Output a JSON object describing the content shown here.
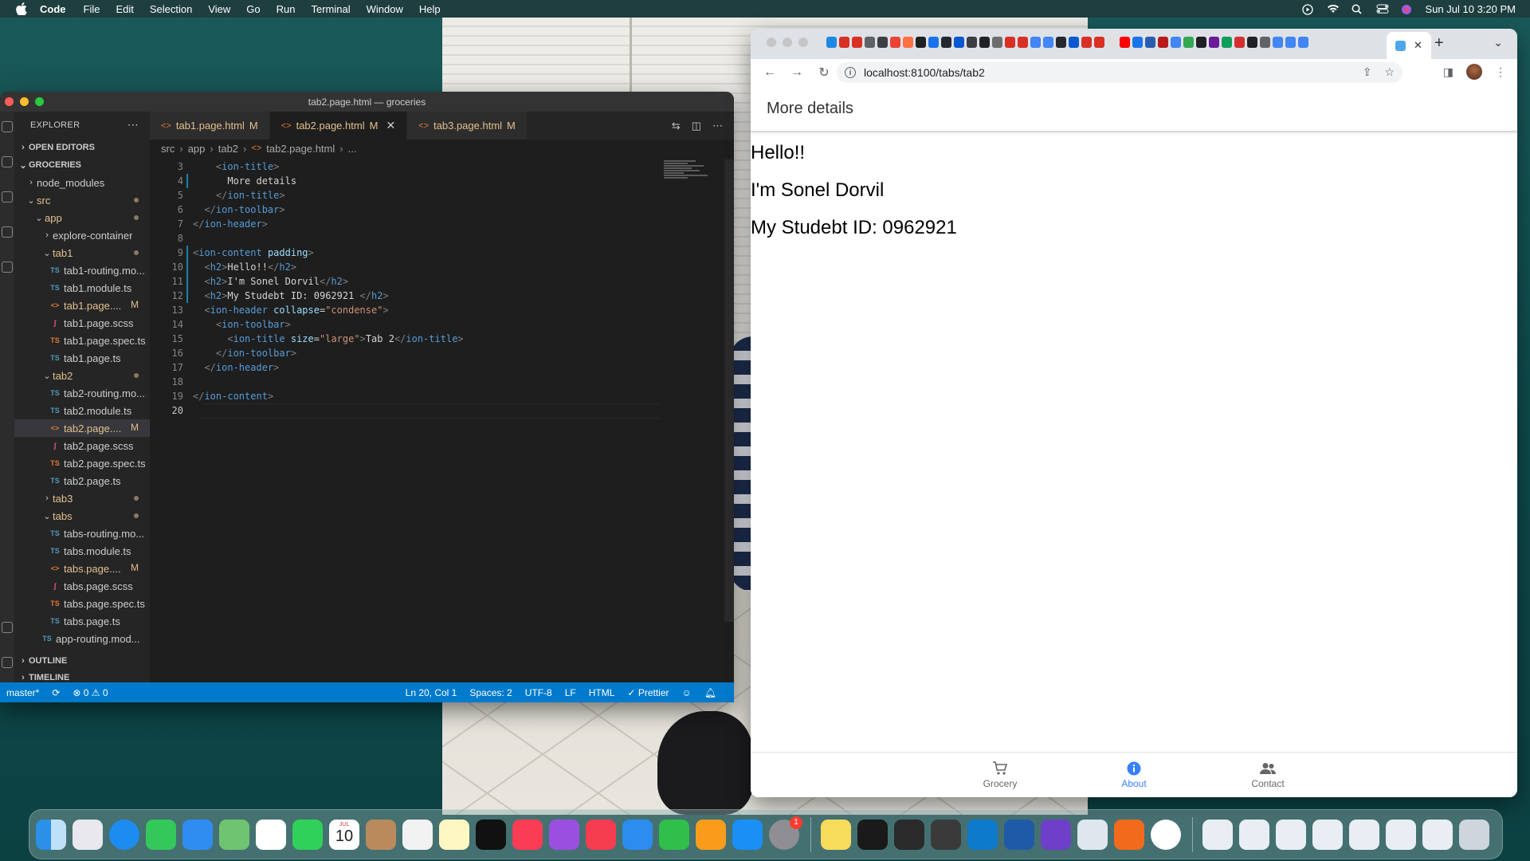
{
  "menubar": {
    "app_name": "Code",
    "items": [
      "File",
      "Edit",
      "Selection",
      "View",
      "Go",
      "Run",
      "Terminal",
      "Window",
      "Help"
    ],
    "datetime": "Sun Jul 10  3:20 PM"
  },
  "vscode": {
    "window_title": "tab2.page.html — groceries",
    "explorer_label": "EXPLORER",
    "open_editors_label": "OPEN EDITORS",
    "project_label": "GROCERIES",
    "outline_label": "OUTLINE",
    "timeline_label": "TIMELINE",
    "tree": [
      {
        "label": "node_modules",
        "kind": "folder",
        "depth": 1,
        "open": false
      },
      {
        "label": "src",
        "kind": "folder",
        "depth": 1,
        "open": true,
        "dot": true
      },
      {
        "label": "app",
        "kind": "folder",
        "depth": 2,
        "open": true,
        "dot": true
      },
      {
        "label": "explore-container",
        "kind": "folder",
        "depth": 3,
        "open": false
      },
      {
        "label": "tab1",
        "kind": "folder",
        "depth": 3,
        "open": true,
        "dot": true
      },
      {
        "label": "tab1-routing.mo...",
        "kind": "ts",
        "depth": 4
      },
      {
        "label": "tab1.module.ts",
        "kind": "ts",
        "depth": 4
      },
      {
        "label": "tab1.page....",
        "kind": "html",
        "depth": 4,
        "mod": "M"
      },
      {
        "label": "tab1.page.scss",
        "kind": "scss",
        "depth": 4
      },
      {
        "label": "tab1.page.spec.ts",
        "kind": "spec",
        "depth": 4
      },
      {
        "label": "tab1.page.ts",
        "kind": "ts",
        "depth": 4
      },
      {
        "label": "tab2",
        "kind": "folder",
        "depth": 3,
        "open": true,
        "dot": true
      },
      {
        "label": "tab2-routing.mo...",
        "kind": "ts",
        "depth": 4
      },
      {
        "label": "tab2.module.ts",
        "kind": "ts",
        "depth": 4
      },
      {
        "label": "tab2.page....",
        "kind": "html",
        "depth": 4,
        "mod": "M",
        "selected": true
      },
      {
        "label": "tab2.page.scss",
        "kind": "scss",
        "depth": 4
      },
      {
        "label": "tab2.page.spec.ts",
        "kind": "spec",
        "depth": 4
      },
      {
        "label": "tab2.page.ts",
        "kind": "ts",
        "depth": 4
      },
      {
        "label": "tab3",
        "kind": "folder",
        "depth": 3,
        "open": false,
        "dot": true
      },
      {
        "label": "tabs",
        "kind": "folder",
        "depth": 3,
        "open": true,
        "dot": true
      },
      {
        "label": "tabs-routing.mo...",
        "kind": "ts",
        "depth": 4
      },
      {
        "label": "tabs.module.ts",
        "kind": "ts",
        "depth": 4
      },
      {
        "label": "tabs.page....",
        "kind": "html",
        "depth": 4,
        "mod": "M"
      },
      {
        "label": "tabs.page.scss",
        "kind": "scss",
        "depth": 4
      },
      {
        "label": "tabs.page.spec.ts",
        "kind": "spec",
        "depth": 4
      },
      {
        "label": "tabs.page.ts",
        "kind": "ts",
        "depth": 4
      },
      {
        "label": "app-routing.mod...",
        "kind": "ts",
        "depth": 3
      }
    ],
    "tabs": [
      {
        "label": "tab1.page.html",
        "mod": "M",
        "active": false
      },
      {
        "label": "tab2.page.html",
        "mod": "M",
        "active": true
      },
      {
        "label": "tab3.page.html",
        "mod": "M",
        "active": false
      }
    ],
    "breadcrumb": [
      "src",
      "app",
      "tab2",
      "tab2.page.html",
      "..."
    ],
    "code_lines": [
      {
        "n": "3",
        "segs": [
          [
            "",
            "    "
          ],
          [
            "br",
            "<"
          ],
          [
            "tag",
            "ion-title"
          ],
          [
            "br",
            ">"
          ]
        ]
      },
      {
        "n": "4",
        "segs": [
          [
            "",
            "      More details"
          ]
        ]
      },
      {
        "n": "5",
        "segs": [
          [
            "",
            "    "
          ],
          [
            "br",
            "</"
          ],
          [
            "tag",
            "ion-title"
          ],
          [
            "br",
            ">"
          ]
        ]
      },
      {
        "n": "6",
        "segs": [
          [
            "",
            "  "
          ],
          [
            "br",
            "</"
          ],
          [
            "tag",
            "ion-toolbar"
          ],
          [
            "br",
            ">"
          ]
        ]
      },
      {
        "n": "7",
        "segs": [
          [
            "br",
            "</"
          ],
          [
            "tag",
            "ion-header"
          ],
          [
            "br",
            ">"
          ]
        ]
      },
      {
        "n": "8",
        "segs": [
          [
            "",
            ""
          ]
        ]
      },
      {
        "n": "9",
        "segs": [
          [
            "br",
            "<"
          ],
          [
            "tag",
            "ion-content"
          ],
          [
            "",
            " "
          ],
          [
            "attr",
            "padding"
          ],
          [
            "br",
            ">"
          ]
        ]
      },
      {
        "n": "10",
        "segs": [
          [
            "",
            "  "
          ],
          [
            "br",
            "<"
          ],
          [
            "tag",
            "h2"
          ],
          [
            "br",
            ">"
          ],
          [
            "",
            "Hello!!"
          ],
          [
            "br",
            "</"
          ],
          [
            "tag",
            "h2"
          ],
          [
            "br",
            ">"
          ]
        ]
      },
      {
        "n": "11",
        "segs": [
          [
            "",
            "  "
          ],
          [
            "br",
            "<"
          ],
          [
            "tag",
            "h2"
          ],
          [
            "br",
            ">"
          ],
          [
            "",
            "I'm Sonel Dorvil"
          ],
          [
            "br",
            "</"
          ],
          [
            "tag",
            "h2"
          ],
          [
            "br",
            ">"
          ]
        ]
      },
      {
        "n": "12",
        "segs": [
          [
            "",
            "  "
          ],
          [
            "br",
            "<"
          ],
          [
            "tag",
            "h2"
          ],
          [
            "br",
            ">"
          ],
          [
            "",
            "My Studebt ID: 0962921 "
          ],
          [
            "br",
            "</"
          ],
          [
            "tag",
            "h2"
          ],
          [
            "br",
            ">"
          ]
        ]
      },
      {
        "n": "13",
        "segs": [
          [
            "",
            "  "
          ],
          [
            "br",
            "<"
          ],
          [
            "tag",
            "ion-header"
          ],
          [
            "",
            " "
          ],
          [
            "attr",
            "collapse"
          ],
          [
            "",
            "="
          ],
          [
            "str",
            "\"condense\""
          ],
          [
            "br",
            ">"
          ]
        ]
      },
      {
        "n": "14",
        "segs": [
          [
            "",
            "    "
          ],
          [
            "br",
            "<"
          ],
          [
            "tag",
            "ion-toolbar"
          ],
          [
            "br",
            ">"
          ]
        ]
      },
      {
        "n": "15",
        "segs": [
          [
            "",
            "      "
          ],
          [
            "br",
            "<"
          ],
          [
            "tag",
            "ion-title"
          ],
          [
            "",
            " "
          ],
          [
            "attr",
            "size"
          ],
          [
            "",
            "="
          ],
          [
            "str",
            "\"large\""
          ],
          [
            "br",
            ">"
          ],
          [
            "",
            "Tab 2"
          ],
          [
            "br",
            "</"
          ],
          [
            "tag",
            "ion-title"
          ],
          [
            "br",
            ">"
          ]
        ]
      },
      {
        "n": "16",
        "segs": [
          [
            "",
            "    "
          ],
          [
            "br",
            "</"
          ],
          [
            "tag",
            "ion-toolbar"
          ],
          [
            "br",
            ">"
          ]
        ]
      },
      {
        "n": "17",
        "segs": [
          [
            "",
            "  "
          ],
          [
            "br",
            "</"
          ],
          [
            "tag",
            "ion-header"
          ],
          [
            "br",
            ">"
          ]
        ]
      },
      {
        "n": "18",
        "segs": [
          [
            "",
            ""
          ]
        ]
      },
      {
        "n": "19",
        "segs": [
          [
            "br",
            "</"
          ],
          [
            "tag",
            "ion-content"
          ],
          [
            "br",
            ">"
          ]
        ]
      },
      {
        "n": "20",
        "segs": [
          [
            "",
            ""
          ]
        ],
        "current": true
      }
    ],
    "status": {
      "branch": "master*",
      "problems": "⊗ 0 ⚠ 0",
      "cursor": "Ln 20, Col 1",
      "spaces": "Spaces: 2",
      "encoding": "UTF-8",
      "eol": "LF",
      "language": "HTML",
      "formatter": "Prettier"
    }
  },
  "chrome": {
    "url": "localhost:8100/tabs/tab2",
    "app_header": "More details",
    "headings": [
      "Hello!!",
      "I'm Sonel Dorvil",
      "My Studebt ID: 0962921"
    ],
    "tabbar": [
      {
        "label": "Grocery",
        "icon": "cart-icon",
        "active": false
      },
      {
        "label": "About",
        "icon": "info-icon",
        "active": true
      },
      {
        "label": "Contact",
        "icon": "people-icon",
        "active": false
      }
    ],
    "accent_color": "#3880ff"
  },
  "dock": {
    "calendar_month": "JUL",
    "calendar_day": "10",
    "badge_count": "1"
  }
}
